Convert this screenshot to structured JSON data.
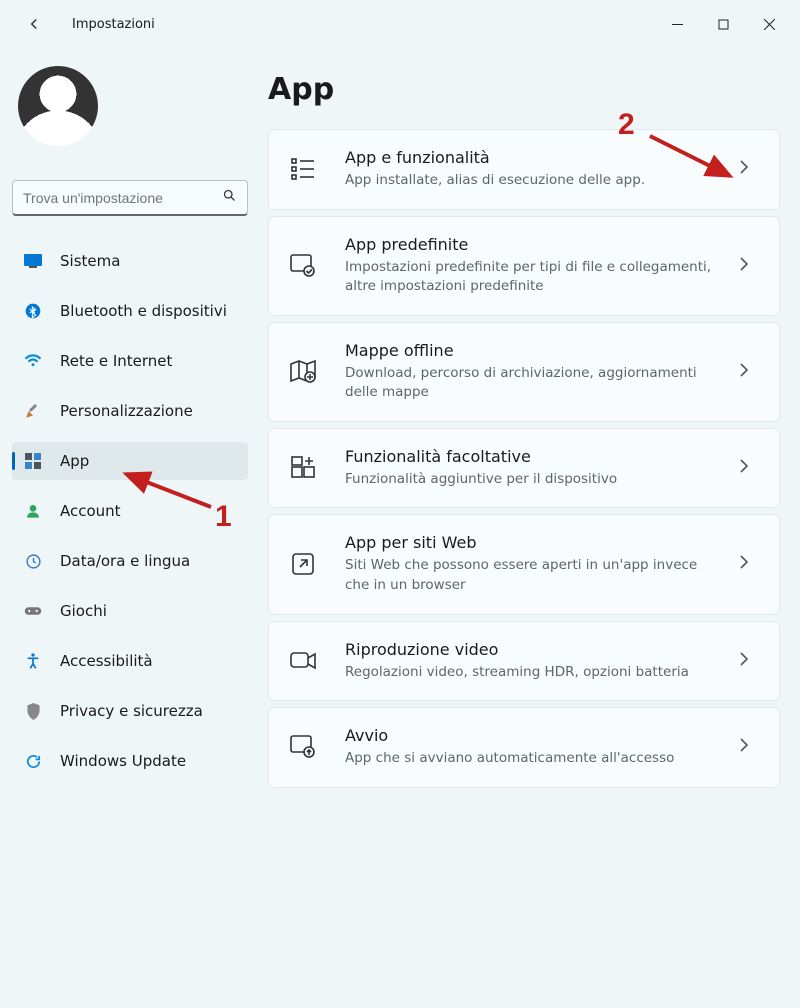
{
  "window_title": "Impostazioni",
  "search": {
    "placeholder": "Trova un'impostazione"
  },
  "nav": [
    {
      "label": "Sistema",
      "id": "sistema"
    },
    {
      "label": "Bluetooth e dispositivi",
      "id": "bluetooth"
    },
    {
      "label": "Rete e Internet",
      "id": "rete"
    },
    {
      "label": "Personalizzazione",
      "id": "personalizzazione"
    },
    {
      "label": "App",
      "id": "app"
    },
    {
      "label": "Account",
      "id": "account"
    },
    {
      "label": "Data/ora e lingua",
      "id": "dataora"
    },
    {
      "label": "Giochi",
      "id": "giochi"
    },
    {
      "label": "Accessibilità",
      "id": "accessibilita"
    },
    {
      "label": "Privacy e sicurezza",
      "id": "privacy"
    },
    {
      "label": "Windows Update",
      "id": "update"
    }
  ],
  "active_nav_index": 4,
  "page_heading": "App",
  "cards": [
    {
      "title": "App e funzionalità",
      "sub": "App installate, alias di esecuzione delle app."
    },
    {
      "title": "App predefinite",
      "sub": "Impostazioni predefinite per tipi di file e collegamenti, altre impostazioni predefinite"
    },
    {
      "title": "Mappe offline",
      "sub": "Download, percorso di archiviazione, aggiornamenti delle mappe"
    },
    {
      "title": "Funzionalità facoltative",
      "sub": "Funzionalità aggiuntive per il dispositivo"
    },
    {
      "title": "App per siti Web",
      "sub": "Siti Web che possono essere aperti in un'app invece che in un browser"
    },
    {
      "title": "Riproduzione video",
      "sub": "Regolazioni video, streaming HDR, opzioni batteria"
    },
    {
      "title": "Avvio",
      "sub": "App che si avviano automaticamente all'accesso"
    }
  ],
  "annotations": {
    "n1": "1",
    "n2": "2"
  }
}
